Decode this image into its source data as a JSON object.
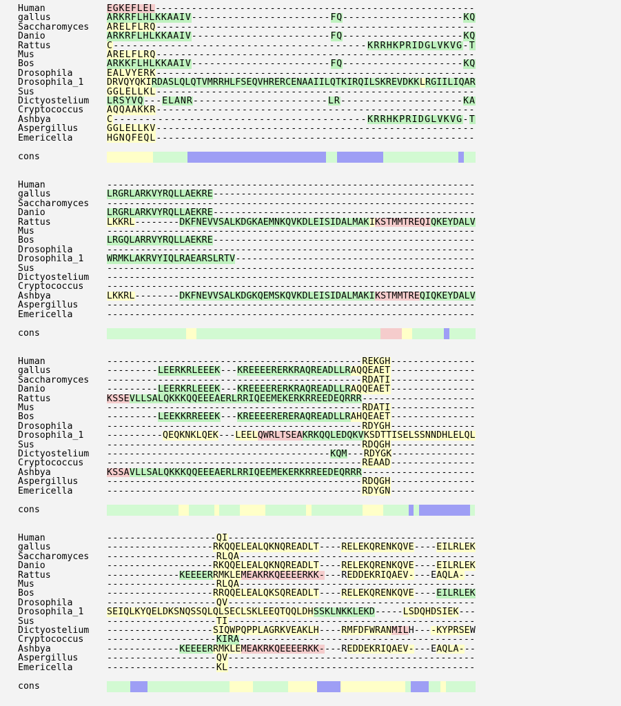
{
  "cons_label": "cons",
  "colors": {
    "y": "#ffffc8",
    "g": "#d2fad2",
    "G": "#bff2bf",
    "p": "#f5cccc",
    "b": "#9e9ef5",
    "n": "transparent"
  },
  "blocks": [
    {
      "rows": [
        {
          "name": "Human",
          "seq": "EGKEFLEL-----------------------------------------------------",
          "hl": "pppppppp"
        },
        {
          "name": "gallus",
          "seq": "ARKRFLHLKKAAIV-----------------------FQ--------------------KQ",
          "hl": "GGGGGGGGGGGGGGnnnnnnnnnnnnnnnnnnnnnnnGGnnnnnnnnnnnnnnnnnnnnGG"
        },
        {
          "name": "Saccharomyces",
          "seq": "ARELFLRQ----------------------------------------------------",
          "hl": "yyyyyyyy"
        },
        {
          "name": "Danio",
          "seq": "ARKRFLHLKKAAIV-----------------------FQ--------------------KQ",
          "hl": "GGGGGGGGGGGGGGnnnnnnnnnnnnnnnnnnnnnnnGGnnnnnnnnnnnnnnnnnnnnGG"
        },
        {
          "name": "Rattus",
          "seq": "C----------------------------------------KRRHKPRIDGLVKVG-T",
          "hl": "ynnnnnnnnnnnnnnnnnnnnnnnnnnnnnnnnnnnnnnnnGGGGGGGGGGGGGGGnG"
        },
        {
          "name": "Mus",
          "seq": "ARELFLRQ----------------------------------------------------",
          "hl": "yyyyyyyy"
        },
        {
          "name": "Bos",
          "seq": "ARKKFLHLKKAAIV-----------------------FQ--------------------KQ",
          "hl": "GGGGGGGGGGGGGGnnnnnnnnnnnnnnnnnnnnnnnGGnnnnnnnnnnnnnnnnnnnnGG"
        },
        {
          "name": "Drosophila",
          "seq": "EALVYERK----------------------------------------------------",
          "hl": "yyyyyyyy"
        },
        {
          "name": "Drosophila_1",
          "seq": "DRVQYQKIRDASLQLQTVMRRHLFSEQVHRERCENAAIILQTKIRQILSKREVDKKLRGIILIQAR",
          "hl": "yyyyyyyyGGGGGGGGGGGGGGGGGGGGGGGGGGGGGGGGGGGGGGGGGGGGGGGGyGGGGGGGGGG"
        },
        {
          "name": "Sus",
          "seq": "GGLELLKL----------------------------------------------------",
          "hl": "yyyyyyyy"
        },
        {
          "name": "Dictyostelium",
          "seq": "LRSYVQ---ELANR----------------------LR--------------------KA",
          "hl": "GGGGGGnnnGGGGGnnnnnnnnnnnnnnnnnnnnnnGGnnnnnnnnnnnnnnnnnnnnGG"
        },
        {
          "name": "Cryptococcus",
          "seq": "AQQAAKKR----------------------------------------------------",
          "hl": "yyyyyyyy"
        },
        {
          "name": "Ashbya",
          "seq": "C----------------------------------------KRRHKPRIDGLVKVG-T",
          "hl": "ynnnnnnnnnnnnnnnnnnnnnnnnnnnnnnnnnnnnnnnnGGGGGGGGGGGGGGGnG"
        },
        {
          "name": "Aspergillus",
          "seq": "GGLELLKV----------------------------------------------------",
          "hl": "yyyyyyyy"
        },
        {
          "name": "Emericella",
          "seq": "HGNQFEQL----------------------------------------------------",
          "hl": "yyyyyyyy"
        }
      ],
      "cons": "yyyyyyyyggggggbbbbbbbbbbbbbbbbbbbbbbbbggbbbbbbbbgggggggggggggbgg"
    },
    {
      "rows": [
        {
          "name": "Human",
          "seq": "------------------------------------------------------------------",
          "hl": ""
        },
        {
          "name": "gallus",
          "seq": "LRGRLARKVYRQLLAEKRE-----------------------------------------------",
          "hl": "GGGGGGGGGGGGGGGGGGG"
        },
        {
          "name": "Saccharomyces",
          "seq": "------------------------------------------------------------------",
          "hl": ""
        },
        {
          "name": "Danio",
          "seq": "LRGRLARKVYRQLLAEKRE-----------------------------------------------",
          "hl": "GGGGGGGGGGGGGGGGGGG"
        },
        {
          "name": "Rattus",
          "seq": "LKKRL--------DKFNEVVSALKDGKAEMNKQVKDLEISIDALMAKIKSTMMTREQIQKEYDALV",
          "hl": "yyyyynnnnnnnnGGGGGGGGGGGGGGGGGGGGGGGGGGGGGGGGGGyppppppppppGGGGGGGG"
        },
        {
          "name": "Mus",
          "seq": "------------------------------------------------------------------",
          "hl": ""
        },
        {
          "name": "Bos",
          "seq": "LRGQLARRVYRQLLAEKRE-----------------------------------------------",
          "hl": "GGGGGGGGGGGGGGGGGGG"
        },
        {
          "name": "Drosophila",
          "seq": "------------------------------------------------------------------",
          "hl": ""
        },
        {
          "name": "Drosophila_1",
          "seq": "WRMKLAKRVYIQLRAEARSLRTV-------------------------------------------",
          "hl": "GGGGGGGGGGGGGGGGGGGGGGG"
        },
        {
          "name": "Sus",
          "seq": "------------------------------------------------------------------",
          "hl": ""
        },
        {
          "name": "Dictyostelium",
          "seq": "------------------------------------------------------------------",
          "hl": ""
        },
        {
          "name": "Cryptococcus",
          "seq": "------------------------------------------------------------------",
          "hl": ""
        },
        {
          "name": "Ashbya",
          "seq": "LKKRL--------DKFNEVVSALKDGKQEMSKQVKDLEISIDALMAKIKSTMMTREQIQKEYDALV",
          "hl": "yyyyynnnnnnnnGGGGGGGGGGGGGGGGGGGGGGGGGGGGGGGGGGGppppppppGGGGGGGGGG"
        },
        {
          "name": "Aspergillus",
          "seq": "------------------------------------------------------------------",
          "hl": ""
        },
        {
          "name": "Emericella",
          "seq": "------------------------------------------------------------------",
          "hl": ""
        }
      ],
      "cons": "gggggggggggggggyygggggggggggggggggggggggggggggggggggppppyyggggggbggggg"
    },
    {
      "rows": [
        {
          "name": "Human",
          "seq": "---------------------------------------------REKGH---------------",
          "hl": "nnnnnnnnnnnnnnnnnnnnnnnnnnnnnnnnnnnnnnnnnnnnnyyyyy"
        },
        {
          "name": "gallus",
          "seq": "---------LEERKRLEEEK---KREEEERERKRAQREADLLRAQQEAET---------------",
          "hl": "nnnnnnnnnGGGGGGGGGGGnnnGGGGGGGGGGGGGGGGGGGGyyyyyyy"
        },
        {
          "name": "Saccharomyces",
          "seq": "---------------------------------------------RDATI---------------",
          "hl": "nnnnnnnnnnnnnnnnnnnnnnnnnnnnnnnnnnnnnnnnnnnnnyyyyy"
        },
        {
          "name": "Danio",
          "seq": "---------LEERKRLEEEK---KREEEERERKRAQREADLLRAQQEAET---------------",
          "hl": "nnnnnnnnnGGGGGGGGGGGnnnGGGGGGGGGGGGGGGGGGGGyyyyyyy"
        },
        {
          "name": "Rattus",
          "seq": "KSSEVLLSALQKKKQQEEEAERLRRIQEEMEKERKRREEDEQRRR--------------------",
          "hl": "ppppGGGGGGGGGGGGGGGGGGGGGGGGGGGGGGGGGGGGGGGGG"
        },
        {
          "name": "Mus",
          "seq": "---------------------------------------------RDATI---------------",
          "hl": "nnnnnnnnnnnnnnnnnnnnnnnnnnnnnnnnnnnnnnnnnnnnnyyyyy"
        },
        {
          "name": "Bos",
          "seq": "---------LEEKKRREEEK---KREEEERERERAQREADLLRAHQEAET---------------",
          "hl": "nnnnnnnnnGGGGGGGGGGGnnnGGGGGGGGGGGGGGGGGGGGyyyyyyy"
        },
        {
          "name": "Drosophila",
          "seq": "---------------------------------------------RDYGH---------------",
          "hl": "nnnnnnnnnnnnnnnnnnnnnnnnnnnnnnnnnnnnnnnnnnnnnyyyyy"
        },
        {
          "name": "Drosophila_1",
          "seq": "----------QEQKNKLQEK---LEELQWRLTSEAKRKQQLEDQKVKSDTTISELSSNNDHLELQL",
          "hl": "nnnnnnnnnnyyyyyyyyyynnnyyyyppppppppGGGGGGGGGGGyyyyyyyyyyyyyyyyyyyyy"
        },
        {
          "name": "Sus",
          "seq": "---------------------------------------------RDQGH---------------",
          "hl": "nnnnnnnnnnnnnnnnnnnnnnnnnnnnnnnnnnnnnnnnnnnnnyyyyy"
        },
        {
          "name": "Dictyostelium",
          "seq": "----------------------------------------KQM---RDYGK---------------",
          "hl": "nnnnnnnnnnnnnnnnnnnnnnnnnnnnnnnnnnnnnnnnGGGnnnyyyyy"
        },
        {
          "name": "Cryptococcus",
          "seq": "---------------------------------------------REAAD---------------",
          "hl": "nnnnnnnnnnnnnnnnnnnnnnnnnnnnnnnnnnnnnnnnnnnnnyyyyy"
        },
        {
          "name": "Ashbya",
          "seq": "KSSAVLLSALQKKKQQEEEAERLRRIQEEMEKERKRREEDEQRRR--------------------",
          "hl": "ppppGGGGGGGGGGGGGGGGGGGGGGGGGGGGGGGGGGGGGGGGG"
        },
        {
          "name": "Aspergillus",
          "seq": "---------------------------------------------RDQGH---------------",
          "hl": "nnnnnnnnnnnnnnnnnnnnnnnnnnnnnnnnnnnnnnnnnnnnnyyyyy"
        },
        {
          "name": "Emericella",
          "seq": "---------------------------------------------RDYGN---------------",
          "hl": "nnnnnnnnnnnnnnnnnnnnnnnnnnnnnnnnnnnnnnnnnnnnnyyyyy"
        }
      ],
      "cons": "ggggggggggggggyygggggyggggyyyyyggggggggyggggggggggyyyygggggbgbbbbbbbbbbg"
    },
    {
      "rows": [
        {
          "name": "Human",
          "seq": "-------------------QI-------------------------------------------",
          "hl": "nnnnnnnnnnnnnnnnnnnyy"
        },
        {
          "name": "gallus",
          "seq": "-------------------RKQQELEALQKNQREADLT----RELEKQRENKQVE----EILRLEK",
          "hl": "nnnnnnnnnnnnnnnnnnnyyyyyyyyyyyyyyyyyyynnnnyyyyyyyyyyyyynnnnyyyyyyy"
        },
        {
          "name": "Saccharomyces",
          "seq": "-------------------RLQA-----------------------------------------",
          "hl": "nnnnnnnnnnnnnnnnnnnyyyy"
        },
        {
          "name": "Danio",
          "seq": "-------------------RKQQELEALQKNQREADLT----RELEKQRENKQVE----EILRLEK",
          "hl": "nnnnnnnnnnnnnnnnnnnyyyyyyyyyyyyyyyyyyynnnnyyyyyyyyyyyyynnnnyyyyyyy"
        },
        {
          "name": "Rattus",
          "seq": "-------------KEEEERRMKLEMEAKRKQEEEERKK----REDDEKRIQAEV----EAQLA---",
          "hl": "nnnnnnnnnnnnnGGGGGGyyyyypppppppppppppppnnnnyyyyyyyyyyyynnnnyyyyy"
        },
        {
          "name": "Mus",
          "seq": "-------------------RLQA-----------------------------------------",
          "hl": "nnnnnnnnnnnnnnnnnnnyyyy"
        },
        {
          "name": "Bos",
          "seq": "-------------------RRQQELEALQKSQREADLT----RELEKQRENKQVE----EILRLEK",
          "hl": "nnnnnnnnnnnnnnnnnnnyyyyyyyyyyyyyyyyyyynnnnyyyyyyyyyyyyynnnnGGGGGGG"
        },
        {
          "name": "Drosophila",
          "seq": "-------------------QV-------------------------------------------",
          "hl": "nnnnnnnnnnnnnnnnnnnyy"
        },
        {
          "name": "Drosophila_1",
          "seq": "SEIQLKYQELDKSNQSSQLQLSECLSKLEEQTQQLDHSSKLNKKLEKD-----LSDQHDSIEK---",
          "hl": "yyyyyyyyyyyyyyyyyyyyyyyyyyyyyyyyyyyyyGGGGGGGGGGGnnnnnyyyyyyyyyy"
        },
        {
          "name": "Sus",
          "seq": "-------------------TI-------------------------------------------",
          "hl": "nnnnnnnnnnnnnnnnnnnyy"
        },
        {
          "name": "Dictyostelium",
          "seq": "-------------------SIQWPQPPLAGRKVEAKLH----RMFDFWRANMILH----KYPRSEW",
          "hl": "nnnnnnnnnnnnnnnnnnnyyyyyyyyyyyyyyyyyyynnnnyyyyyyyyypppnnnnyyyyyyy"
        },
        {
          "name": "Cryptococcus",
          "seq": "-------------------KIRA-----------------------------------------",
          "hl": "nnnnnnnnnnnnnnnnnnnGGGG"
        },
        {
          "name": "Ashbya",
          "seq": "-------------KEEEERRMKLEMEAKRKQEEEERKK----REDDEKRIQAEV----EAQLA---",
          "hl": "nnnnnnnnnnnnnGGGGGGyyyyypppppppppppppppnnnnyyyyyyyyyyyynnnnyyyyy"
        },
        {
          "name": "Aspergillus",
          "seq": "-------------------QV-------------------------------------------",
          "hl": "nnnnnnnnnnnnnnnnnnnyy"
        },
        {
          "name": "Emericella",
          "seq": "-------------------KL-------------------------------------------",
          "hl": "nnnnnnnnnnnnnnnnnnnyy"
        }
      ],
      "cons": "ggggbbbggggggggggggggyyyyggggggyyyyybbbbyyyyyyyyyyygbbbggyggggg"
    }
  ]
}
